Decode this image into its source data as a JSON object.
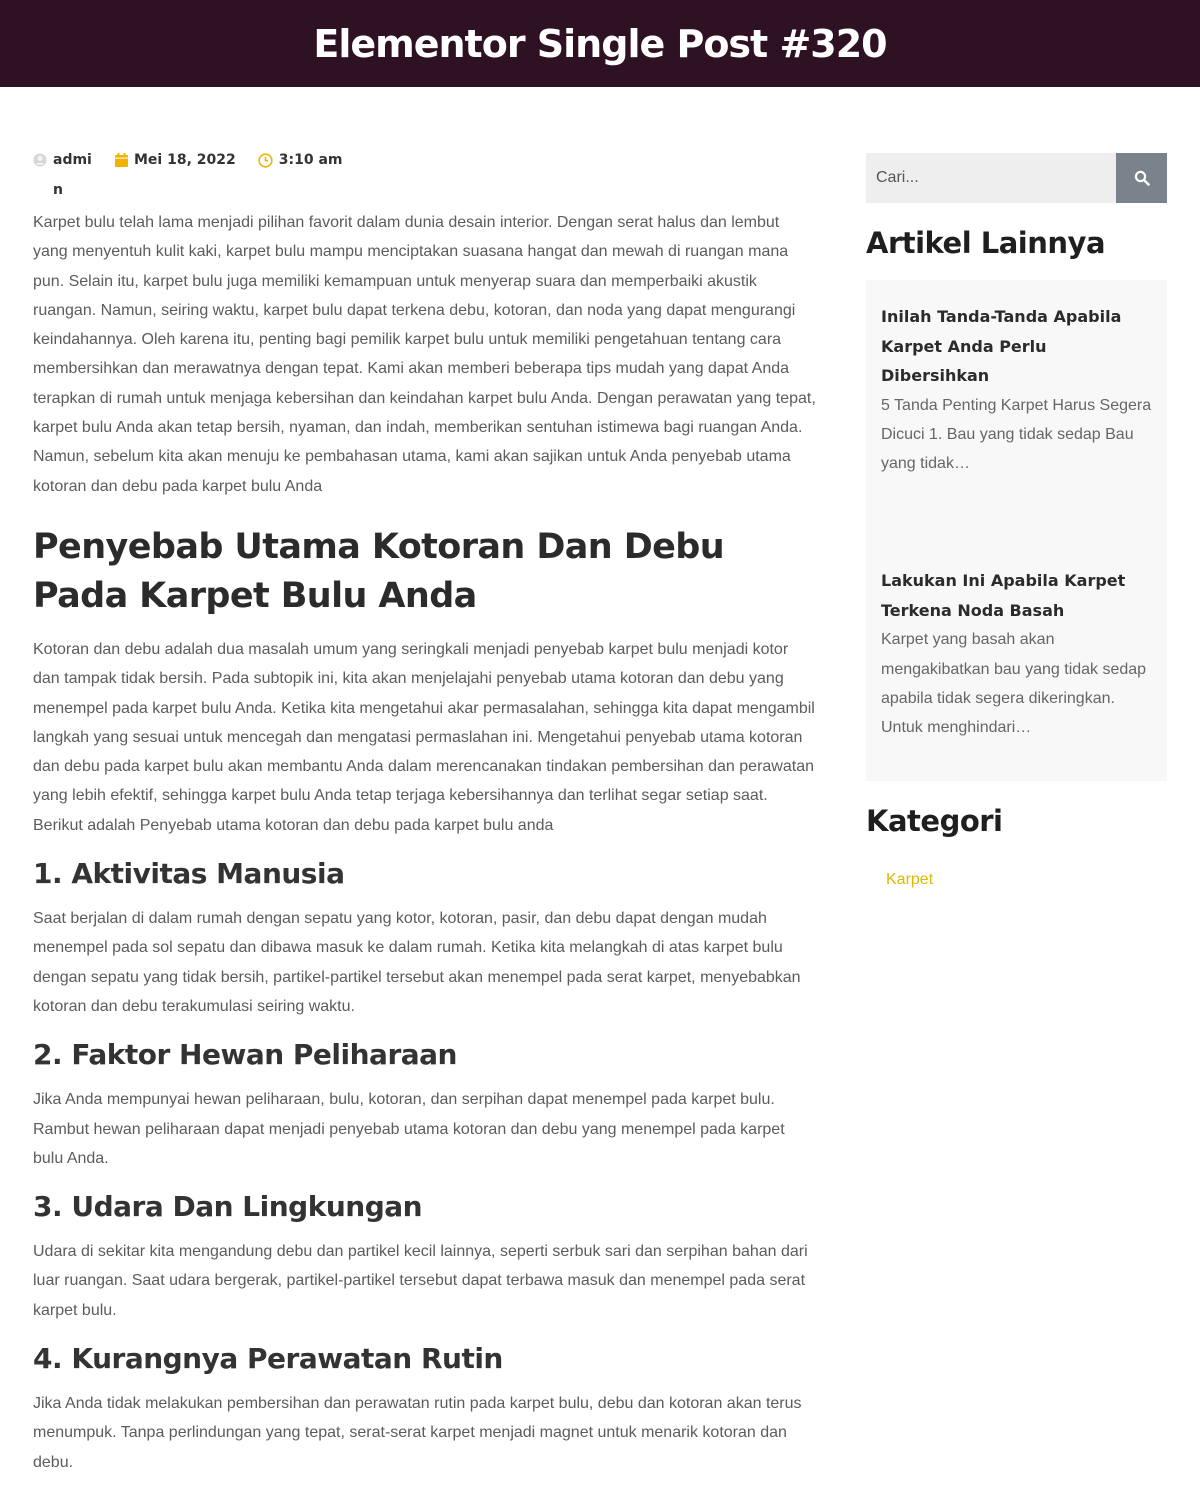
{
  "header": {
    "title": "Elementor Single Post #320"
  },
  "meta": {
    "author": "admin",
    "date": "Mei 18, 2022",
    "time": "3:10 am",
    "colors": {
      "accent": "#f0b400"
    }
  },
  "article": {
    "intro": "Karpet bulu telah lama menjadi pilihan favorit dalam dunia desain interior. Dengan serat halus dan lembut yang menyentuh kulit kaki, karpet bulu mampu menciptakan suasana hangat dan mewah di ruangan mana pun. Selain itu, karpet bulu juga memiliki kemampuan untuk menyerap suara dan memperbaiki akustik ruangan. Namun, seiring waktu, karpet bulu dapat terkena debu, kotoran, dan noda yang dapat mengurangi keindahannya. Oleh karena itu, penting bagi pemilik karpet bulu untuk memiliki pengetahuan tentang cara membersihkan dan merawatnya dengan tepat. Kami akan memberi beberapa tips mudah yang dapat Anda terapkan di rumah untuk menjaga kebersihan dan keindahan karpet bulu Anda. Dengan perawatan yang tepat, karpet bulu Anda akan tetap bersih, nyaman, dan indah, memberikan sentuhan istimewa bagi ruangan Anda. Namun, sebelum kita akan menuju ke pembahasan utama, kami akan sajikan untuk Anda penyebab utama kotoran dan debu pada karpet bulu Anda",
    "heading": "Penyebab Utama Kotoran Dan Debu Pada Karpet Bulu Anda",
    "heading_text": "Kotoran dan debu adalah dua masalah umum yang seringkali menjadi penyebab karpet bulu menjadi kotor dan tampak tidak bersih. Pada subtopik ini, kita akan menjelajahi penyebab utama kotoran dan debu yang menempel pada karpet bulu Anda. Ketika kita mengetahui akar permasalahan, sehingga kita dapat mengambil langkah yang sesuai untuk mencegah dan mengatasi permaslahan ini. Mengetahui penyebab utama kotoran dan debu pada karpet bulu akan membantu Anda dalam merencanakan tindakan pembersihan dan perawatan yang lebih efektif, sehingga karpet bulu Anda tetap terjaga kebersihannya dan terlihat segar setiap saat. Berikut adalah Penyebab utama kotoran dan debu pada karpet bulu anda",
    "sections": [
      {
        "title": "1. Aktivitas Manusia",
        "text": "Saat berjalan di dalam rumah dengan sepatu yang kotor, kotoran, pasir, dan debu dapat dengan mudah menempel pada sol sepatu dan dibawa masuk ke dalam rumah. Ketika kita melangkah di atas karpet bulu dengan sepatu yang tidak bersih, partikel-partikel tersebut akan menempel pada serat karpet, menyebabkan kotoran dan debu terakumulasi seiring waktu."
      },
      {
        "title": "2. Faktor Hewan Peliharaan",
        "text": "Jika Anda mempunyai hewan peliharaan,  bulu, kotoran, dan serpihan dapat menempel pada karpet bulu. Rambut hewan peliharaan dapat menjadi penyebab utama kotoran dan debu yang menempel pada karpet bulu Anda."
      },
      {
        "title": "3. Udara Dan Lingkungan",
        "text": "Udara di sekitar kita mengandung debu dan partikel kecil lainnya, seperti serbuk sari dan serpihan bahan dari luar ruangan. Saat udara bergerak, partikel-partikel tersebut dapat terbawa masuk dan menempel pada serat karpet bulu."
      },
      {
        "title": "4. Kurangnya Perawatan Rutin",
        "text": "Jika Anda tidak melakukan pembersihan dan perawatan rutin pada karpet bulu, debu dan kotoran akan terus menumpuk. Tanpa perlindungan yang tepat, serat-serat karpet menjadi magnet untuk menarik kotoran dan debu."
      }
    ]
  },
  "sidebar": {
    "search": {
      "placeholder": "Cari..."
    },
    "other_articles": {
      "title": "Artikel Lainnya",
      "posts": [
        {
          "title": "Inilah Tanda-Tanda Apabila Karpet Anda Perlu Dibersihkan",
          "excerpt": "5 Tanda Penting Karpet Harus Segera Dicuci 1. Bau yang tidak sedap Bau yang tidak…"
        },
        {
          "title": "Lakukan Ini Apabila Karpet Terkena Noda Basah",
          "excerpt": "Karpet yang basah akan mengakibatkan bau yang tidak sedap apabila tidak segera dikeringkan. Untuk menghindari…"
        }
      ]
    },
    "categories": {
      "title": "Kategori",
      "items": [
        "Karpet"
      ],
      "link_color": "#e0b800"
    }
  }
}
